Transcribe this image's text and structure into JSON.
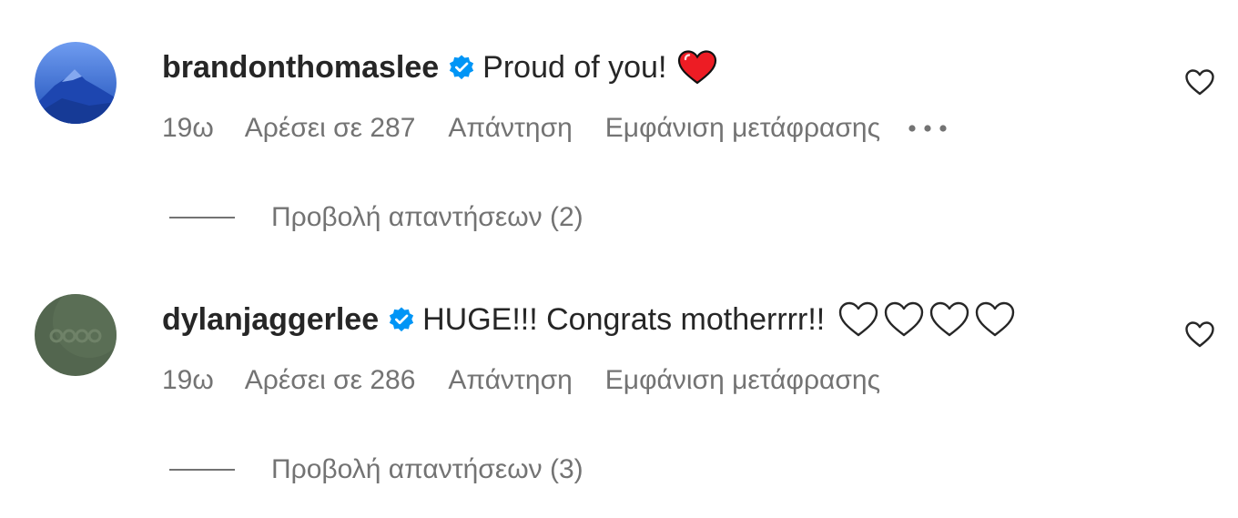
{
  "comments": [
    {
      "username": "brandonthomaslee",
      "verified": true,
      "text": "Proud of you!",
      "emoji": "red-heart",
      "time": "19ω",
      "likes": "Αρέσει σε 287",
      "reply_label": "Απάντηση",
      "translate_label": "Εμφάνιση μετάφρασης",
      "more_label": "•••",
      "view_replies": "Προβολή απαντήσεων (2)",
      "avatar_color": "#2f62c9"
    },
    {
      "username": "dylanjaggerlee",
      "verified": true,
      "text": "HUGE!!! Congrats motherrrr!!",
      "emoji": "white-heart x4",
      "time": "19ω",
      "likes": "Αρέσει σε 286",
      "reply_label": "Απάντηση",
      "translate_label": "Εμφάνιση μετάφρασης",
      "view_replies": "Προβολή απαντήσεων (3)",
      "avatar_color": "#51644e"
    }
  ],
  "colors": {
    "text": "#262626",
    "secondary": "#737373",
    "verified": "#0095f6",
    "heart_red": "#ed1c24"
  }
}
